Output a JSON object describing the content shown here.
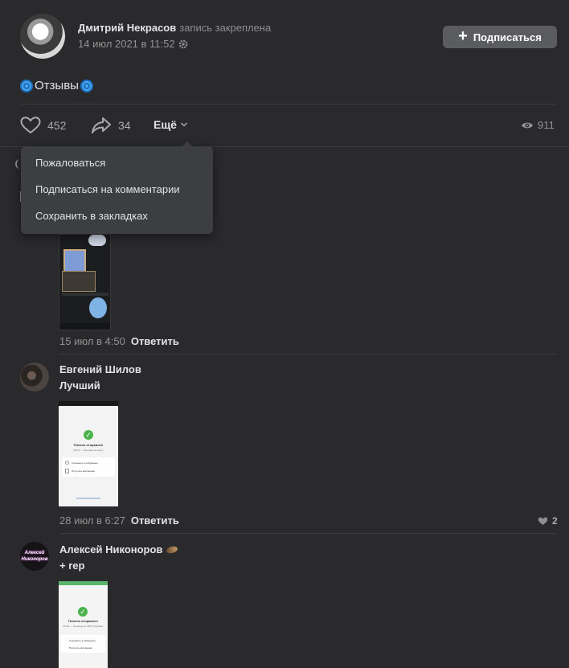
{
  "post": {
    "author": "Дмитрий Некрасов",
    "pinned_note": "запись закреплена",
    "date": "14 июл 2021 в 11:52",
    "subscribe_label": "Подписаться",
    "text": "Отзывы",
    "likes": "452",
    "shares": "34",
    "more_label": "Ещё",
    "views": "911"
  },
  "dropdown": {
    "items": [
      {
        "label": "Пожаловаться"
      },
      {
        "label": "Подписаться на комментарии"
      },
      {
        "label": "Сохранить в закладках"
      }
    ]
  },
  "comments": [
    {
      "date": "15 июл в 4:50",
      "reply_label": "Ответить"
    },
    {
      "author": "Евгений Шилов",
      "text": "Лучший",
      "date": "28 июл в 6:27",
      "reply_label": "Ответить",
      "likes": "2",
      "thumb": {
        "title": "Платеж отправлен",
        "subtitle": "200 ₽ — Перевод на карту",
        "row1": "Сохранить в избранное",
        "row2": "Получить квитанцию"
      }
    },
    {
      "author": "Алексей Никоноров",
      "text": "+ rep",
      "avatar_text": "Алексей Никоноров",
      "thumb": {
        "title": "Платеж отправлен",
        "subtitle": "250 ₽ — Перевод по СБП Сбербанк",
        "row1": "Сохранить в избранное",
        "row2": "Получить квитанцию"
      }
    }
  ],
  "icons": {
    "like": "heart-icon",
    "share": "share-arrow-icon",
    "views": "eye-icon",
    "settings": "gear-icon",
    "chevron": "chevron-down-icon"
  },
  "colors": {
    "background": "#2a2a2c",
    "button": "#5b5c60",
    "dropdown": "#3d3e41",
    "success": "#4bb34b"
  }
}
